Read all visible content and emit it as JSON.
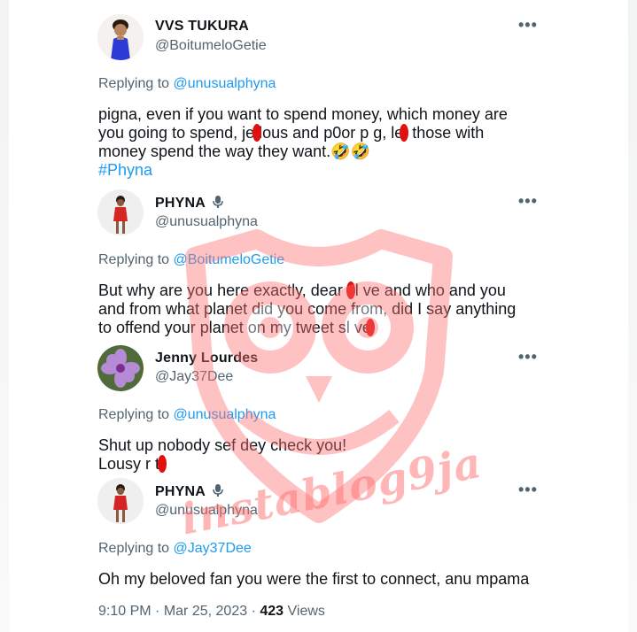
{
  "tweets": [
    {
      "name": "VVS TUKURA",
      "handle": "@BoitumeloGetie",
      "replying_label": "Replying to",
      "replying_to": "@unusualphyna",
      "text": "pigna, even if you want to spend money, which money are\nyou going to spend, je lous and p0or p g, let those with\nmoney spend the way they want.🤣🤣",
      "hashtag": "#Phyna"
    },
    {
      "name": "PHYNA",
      "handle": "@unusualphyna",
      "replying_label": "Replying to",
      "replying_to": "@BoitumeloGetie",
      "text": "But why are you here exactly, dear sl ve and who and you\nand from what planet did you come from, did I say anything\nto offend your planet on my tweet sl ve"
    },
    {
      "name": "Jenny Lourdes",
      "handle": "@Jay37Dee",
      "replying_label": "Replying to",
      "replying_to": "@unusualphyna",
      "text": "Shut up nobody sef dey check you!\nLousy r t"
    },
    {
      "name": "PHYNA",
      "handle": "@unusualphyna",
      "replying_label": "Replying to",
      "replying_to": "@Jay37Dee",
      "text": "Oh my beloved fan you were the first to connect, anu mpama"
    }
  ],
  "more_icon": "more-dots-icon",
  "meta": {
    "time": "9:10 PM",
    "date": "Mar 25, 2023",
    "views_count": "423",
    "views_label": "Views"
  },
  "watermark": "instablog9ja",
  "colors": {
    "link": "#1d9bf0",
    "muted": "#536471",
    "text": "#0f1419",
    "censor": "#e01010",
    "watermark": "#ff6f6f"
  }
}
